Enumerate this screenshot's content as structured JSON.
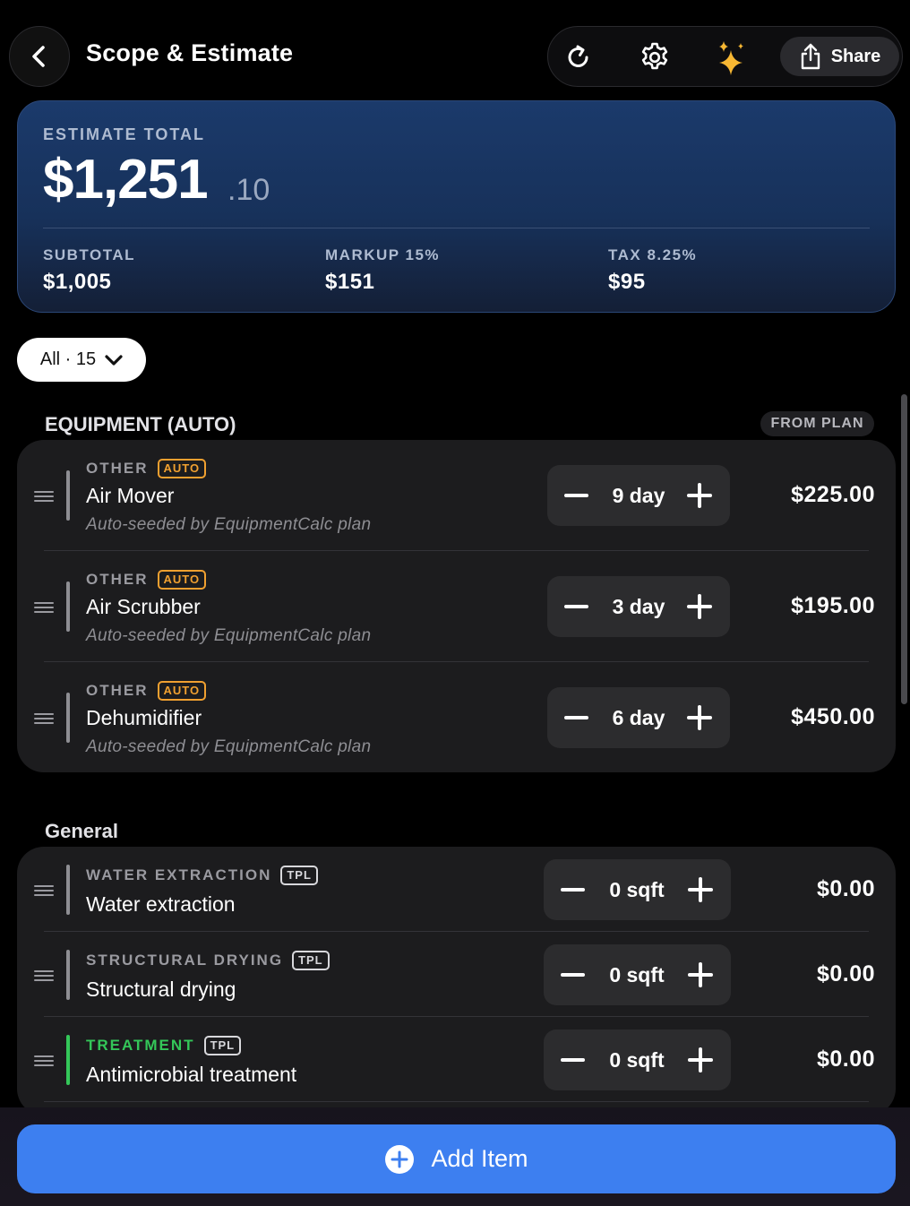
{
  "header": {
    "title": "Scope & Estimate",
    "share_label": "Share"
  },
  "estimate": {
    "label": "ESTIMATE TOTAL",
    "total_whole": "$1,251",
    "total_cents": ".10",
    "subtotal_label": "SUBTOTAL",
    "subtotal_value": "$1,005",
    "markup_label": "MARKUP 15%",
    "markup_value": "$151",
    "tax_label": "TAX 8.25%",
    "tax_value": "$95"
  },
  "filter": {
    "label": "All · 15"
  },
  "sections": [
    {
      "title": "EQUIPMENT (AUTO)",
      "tag": "FROM PLAN",
      "items": [
        {
          "category": "OTHER",
          "badge": "AUTO",
          "name": "Air Mover",
          "note": "Auto-seeded by EquipmentCalc plan",
          "qty": "9 day",
          "price": "$225.00"
        },
        {
          "category": "OTHER",
          "badge": "AUTO",
          "name": "Air Scrubber",
          "note": "Auto-seeded by EquipmentCalc plan",
          "qty": "3 day",
          "price": "$195.00"
        },
        {
          "category": "OTHER",
          "badge": "AUTO",
          "name": "Dehumidifier",
          "note": "Auto-seeded by EquipmentCalc plan",
          "qty": "6 day",
          "price": "$450.00"
        }
      ]
    },
    {
      "title": "General",
      "items": [
        {
          "category": "WATER EXTRACTION",
          "badge": "TPL",
          "name": "Water extraction",
          "qty": "0 sqft",
          "price": "$0.00"
        },
        {
          "category": "STRUCTURAL DRYING",
          "badge": "TPL",
          "name": "Structural drying",
          "qty": "0 sqft",
          "price": "$0.00"
        },
        {
          "category": "TREATMENT",
          "badge": "TPL",
          "name": "Antimicrobial treatment",
          "qty": "0 sqft",
          "price": "$0.00"
        }
      ]
    }
  ],
  "footer": {
    "add_label": "Add Item"
  },
  "colors": {
    "accent": "#3d7ff0",
    "auto_badge": "#f0a030",
    "treatment": "#34c759",
    "card_bg": "#1c1c1e",
    "total_card": "#1b3a6b"
  }
}
